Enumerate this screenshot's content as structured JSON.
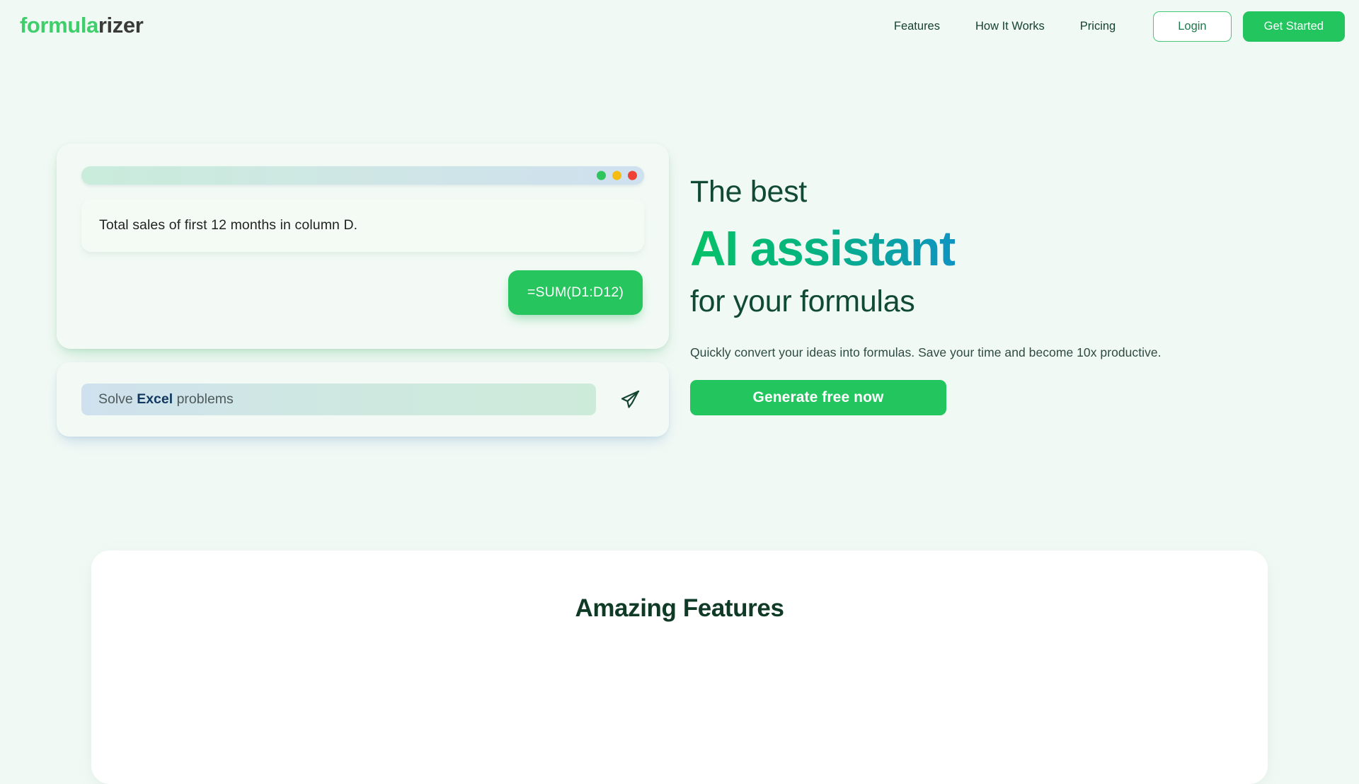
{
  "brand": {
    "logo_part_a": "formula",
    "logo_part_b": "rizer",
    "accent_green": "#22c55e",
    "dark_green": "#114a33",
    "gradient_blue": "#0f94c2"
  },
  "header": {
    "nav": [
      {
        "label": "Features"
      },
      {
        "label": "How It Works"
      },
      {
        "label": "Pricing"
      }
    ],
    "login_label": "Login",
    "get_started_label": "Get Started"
  },
  "hero_mockup": {
    "window_dots": [
      {
        "name": "green",
        "color": "#2ec45e"
      },
      {
        "name": "yellow",
        "color": "#f5bc14"
      },
      {
        "name": "red",
        "color": "#ef4136"
      }
    ],
    "user_message": "Total sales of first 12 months in column D.",
    "formula_reply": "=SUM(D1:D12)",
    "input_placeholder_prefix": "Solve ",
    "input_placeholder_highlight": "Excel",
    "input_placeholder_suffix": " problems",
    "send_icon": "send-paper-plane-icon"
  },
  "hero": {
    "line1": "The best",
    "line2": "AI assistant",
    "line3": "for your formulas",
    "subtitle": "Quickly convert your ideas into formulas. Save your time and become 10x productive.",
    "cta_label": "Generate free now"
  },
  "features": {
    "title": "Amazing Features"
  }
}
